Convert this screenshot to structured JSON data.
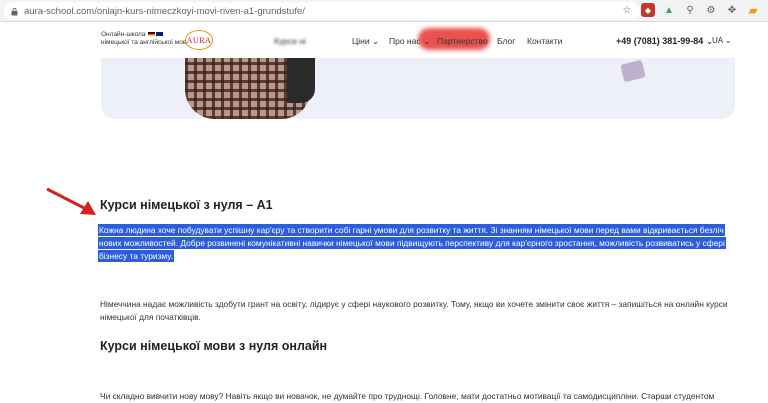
{
  "browser": {
    "url": "aura-school.com/onlajn-kurs-nimeczkoyi-movi-riven-a1-grundstufe/"
  },
  "header": {
    "logo_line1": "Онлайн-школа",
    "logo_line2": "німецької та англійської мов",
    "logo_mark": "AURA",
    "nav": {
      "courses": "Курси ні",
      "promo": "",
      "prices": "Ціни",
      "about": "Про нас",
      "partnership": "Партнерство",
      "blog": "Блог",
      "contacts": "Контакти"
    },
    "phone": "+49 (7081) 381-99-84",
    "language": "UA"
  },
  "content": {
    "heading_main": "Курси німецької з нуля – А1",
    "intro_text": "Кожна людина хоче побудувати успішну кар'єру та створити собі гарні умови для розвитку та життя. Зі знанням німецької мови перед вами відкривається безліч нових можливостей. Добре розвинені комунікативні навички німецької мови підвищують перспективу для кар'єрного зростання, можливість розвиватись у сфері бізнесу та туризму.",
    "paragraph1": "Німеччина надає можливість здобути грант на освіту, лідирує у сфері наукового розвитку. Тому, якщо ви хочете змінити своє життя – запишіться на онлайн курси німецької для початківців.",
    "heading_online": "Курси німецької мови з нуля онлайн",
    "paragraph2": "Чи складно вивчити нову мову? Навіть якщо ви новачок, не думайте про труднощі. Головне, мати достатньо мотивації та самодисципліни. Старши студентом"
  },
  "colors": {
    "highlight": "#2c5ddb",
    "arrow": "#d61f1f",
    "promo": "#e8403c",
    "hero_bg": "#eef0f8"
  },
  "icons": [
    "lock-icon",
    "star-icon",
    "extension-icons",
    "red-arrow-annotation"
  ]
}
